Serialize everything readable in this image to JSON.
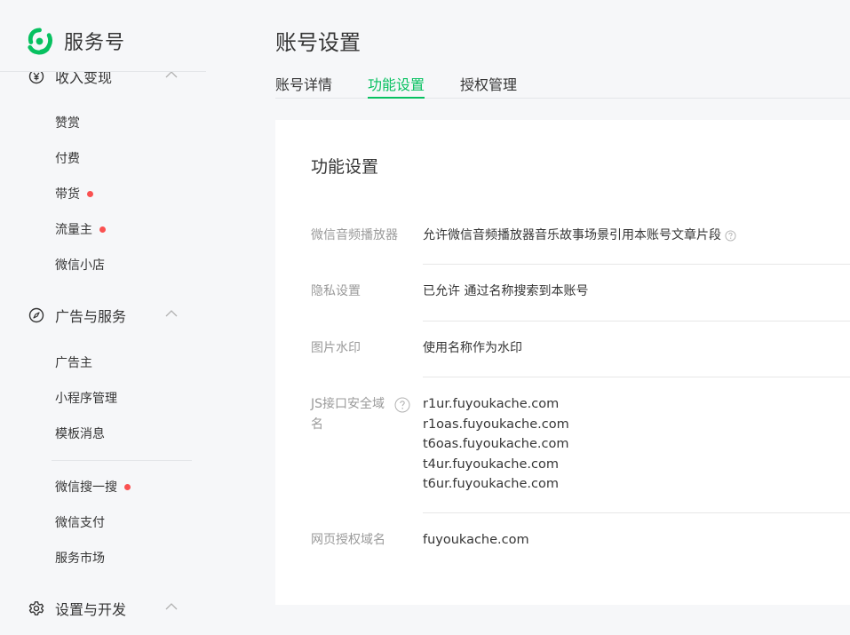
{
  "brand": {
    "name": "服务号",
    "logo_icon": "wechat-service-logo-icon",
    "color": "#07c160"
  },
  "sidebar": {
    "sections": [
      {
        "label": "收入变现",
        "icon": "yuan-circle-icon",
        "items": [
          "赞赏",
          "付费",
          "带货",
          "流量主",
          "微信小店"
        ]
      },
      {
        "label": "广告与服务",
        "icon": "compass-icon",
        "items": [
          "广告主",
          "小程序管理",
          "模板消息",
          "微信搜一搜",
          "微信支付",
          "服务市场"
        ]
      },
      {
        "label": "设置与开发",
        "icon": "gear-icon",
        "items": []
      }
    ],
    "badge_color": "#fa5151"
  },
  "page": {
    "title": "账号设置"
  },
  "tabs": [
    {
      "label": "账号详情",
      "active": false
    },
    {
      "label": "功能设置",
      "active": true
    },
    {
      "label": "授权管理",
      "active": false
    }
  ],
  "card": {
    "title": "功能设置",
    "rows": [
      {
        "label": "微信音频播放器",
        "value": "允许微信音频播放器音乐故事场景引用本账号文章片段"
      },
      {
        "label": "隐私设置",
        "value": "已允许 通过名称搜索到本账号"
      },
      {
        "label": "图片水印",
        "value": "使用名称作为水印"
      },
      {
        "label": "JS接口安全域名",
        "label_line1": "JS接口安全域",
        "label_line2": "名",
        "domains": [
          "r1ur.fuyoukache.com",
          "r1oas.fuyoukache.com",
          "t6oas.fuyoukache.com",
          "t4ur.fuyoukache.com",
          "t6ur.fuyoukache.com"
        ]
      },
      {
        "label": "网页授权域名",
        "value": "fuyoukache.com"
      }
    ]
  }
}
